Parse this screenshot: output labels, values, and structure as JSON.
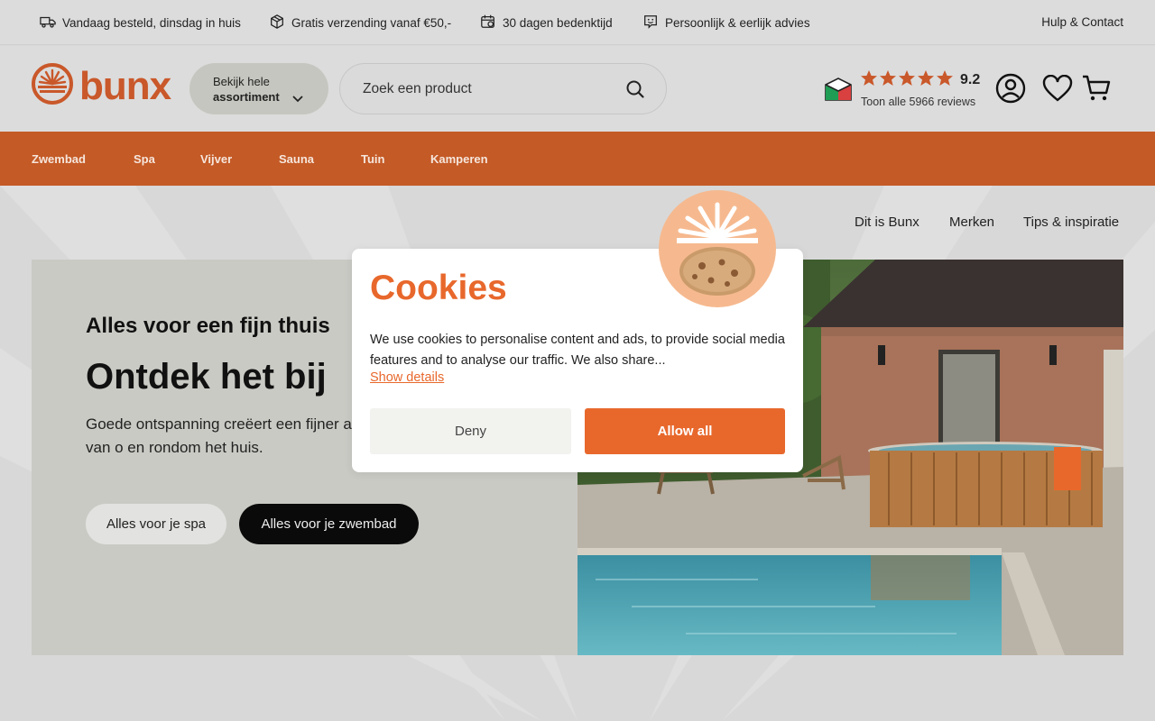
{
  "topbar": {
    "usps": [
      {
        "icon": "delivery-truck-icon",
        "text": "Vandaag besteld, dinsdag in huis"
      },
      {
        "icon": "package-icon",
        "text": "Gratis verzending vanaf €50,-"
      },
      {
        "icon": "return-calendar-icon",
        "text": "30 dagen bedenktijd"
      },
      {
        "icon": "chat-smile-icon",
        "text": "Persoonlijk & eerlijk advies"
      }
    ],
    "help_label": "Hulp & Contact"
  },
  "header": {
    "logo_text": "bunx",
    "assortment_line1": "Bekijk hele",
    "assortment_line2": "assortiment",
    "search_placeholder": "Zoek een product",
    "rating": {
      "stars": 5,
      "score": "9.2",
      "reviews_label": "Toon alle 5966 reviews"
    }
  },
  "catnav": [
    "Zwembad",
    "Spa",
    "Vijver",
    "Sauna",
    "Tuin",
    "Kamperen"
  ],
  "secondary_nav": [
    "Dit is Bunx",
    "Merken",
    "Tips & inspiratie"
  ],
  "hero": {
    "subtitle": "Alles voor een fijn thuis",
    "title": "Ontdek het bij",
    "text": "Goede ontspanning creëert een fijner alle levensgenieters die dromen van o en rondom het huis.",
    "button_spa": "Alles voor je spa",
    "button_pool": "Alles voor je zwembad"
  },
  "cookie": {
    "title": "Cookies",
    "text": "We use cookies to personalise content and ads, to provide social media features and to analyse our traffic. We also share...",
    "details_link": "Show details",
    "deny": "Deny",
    "allow": "Allow all"
  },
  "colors": {
    "brand_orange": "#e8682c",
    "nav_orange": "#c45a26",
    "logo_orange": "#c9582a"
  }
}
